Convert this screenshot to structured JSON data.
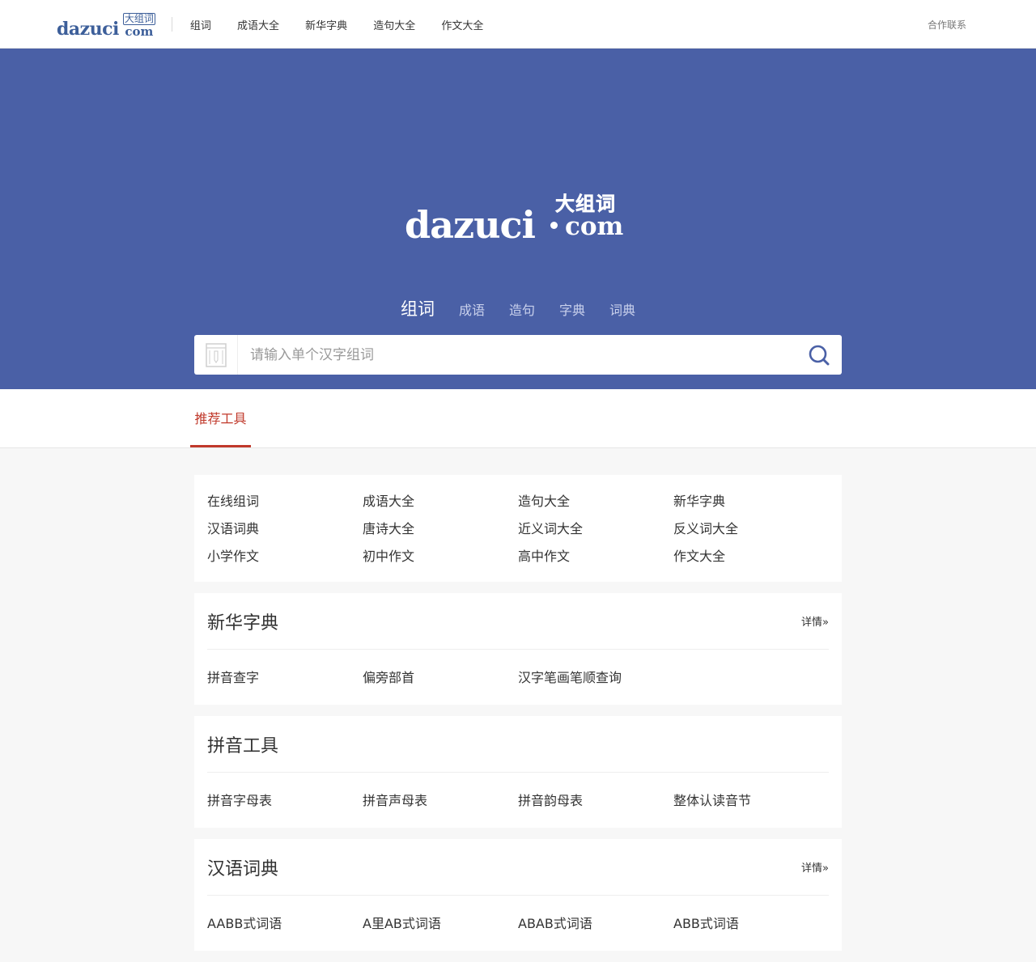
{
  "brand": {
    "logo_text": "dazuci",
    "logo_cn": "大组词",
    "logo_com": "com",
    "hero_logo_text": "dazuci",
    "hero_logo_cn": "大组词",
    "hero_logo_com": "com"
  },
  "topnav": {
    "items": [
      "组词",
      "成语大全",
      "新华字典",
      "造句大全",
      "作文大全"
    ],
    "contact": "合作联系"
  },
  "search_tabs": {
    "items": [
      "组词",
      "成语",
      "造句",
      "字典",
      "词典"
    ],
    "active_index": 0
  },
  "search": {
    "placeholder": "请输入单个汉字组词",
    "value": ""
  },
  "section_tab": "推荐工具",
  "tools": {
    "items": [
      "在线组词",
      "成语大全",
      "造句大全",
      "新华字典",
      "汉语词典",
      "唐诗大全",
      "近义词大全",
      "反义词大全",
      "小学作文",
      "初中作文",
      "高中作文",
      "作文大全"
    ]
  },
  "xinhua": {
    "title": "新华字典",
    "more": "详情»",
    "items": [
      "拼音查字",
      "偏旁部首",
      "汉字笔画笔顺查询"
    ]
  },
  "pinyin": {
    "title": "拼音工具",
    "items": [
      "拼音字母表",
      "拼音声母表",
      "拼音韵母表",
      "整体认读音节"
    ]
  },
  "cidian": {
    "title": "汉语词典",
    "more": "详情»",
    "items": [
      "AABB式词语",
      "A里AB式词语",
      "ABAB式词语",
      "ABB式词语"
    ]
  },
  "colors": {
    "hero_bg": "#4a60a6",
    "accent_red": "#c0392b",
    "logo_blue": "#3d5f9a"
  },
  "icons": {
    "search": "search-icon",
    "dictionary": "dictionary-icon"
  }
}
